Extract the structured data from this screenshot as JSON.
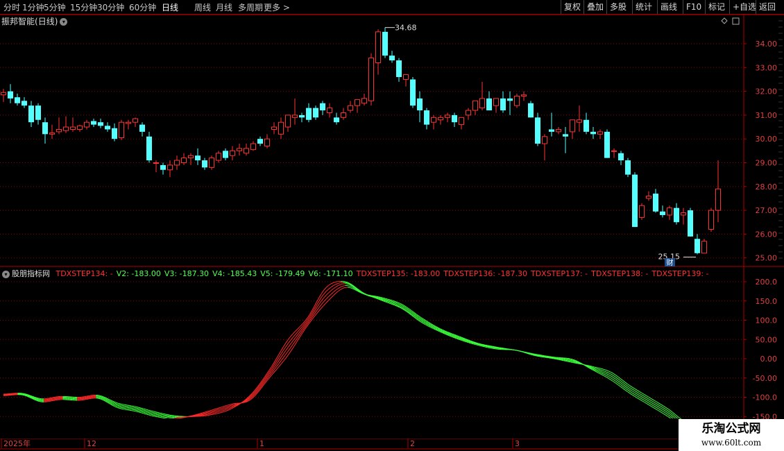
{
  "toolbar": {
    "periods": [
      "分时",
      "1分钟",
      "5分钟",
      "15分钟",
      "30分钟",
      "60分钟",
      "日线",
      "周线",
      "月线",
      "多周期",
      "更多 >"
    ],
    "active_index": 6,
    "right_buttons": [
      "复权",
      "叠加",
      "多股",
      "统计",
      "画线",
      "F10",
      "标记",
      "+自选",
      "返回"
    ]
  },
  "stock": {
    "name": "振邦智能",
    "period": "(日线)"
  },
  "colors": {
    "up": "#ff3232",
    "down": "#54ffff",
    "grid": "#8b0000",
    "axis": "#b00000"
  },
  "price_axis": {
    "labels": [
      "34.00",
      "33.00",
      "32.00",
      "31.00",
      "30.00",
      "29.00",
      "28.00",
      "27.00",
      "26.00",
      "25.00"
    ]
  },
  "annotations": {
    "high": "34.68",
    "low": "25.15",
    "finance_mark": "财"
  },
  "candles": [
    [
      31.85,
      32.1,
      31.55,
      31.95
    ],
    [
      32.0,
      32.3,
      31.5,
      31.7
    ],
    [
      31.75,
      31.9,
      31.4,
      31.5
    ],
    [
      31.6,
      31.75,
      31.3,
      31.4
    ],
    [
      31.4,
      31.6,
      30.5,
      30.7
    ],
    [
      31.4,
      31.5,
      30.6,
      30.8
    ],
    [
      30.7,
      30.9,
      29.8,
      30.2
    ],
    [
      30.2,
      30.6,
      30.0,
      30.25
    ],
    [
      30.3,
      30.9,
      30.2,
      30.4
    ],
    [
      30.35,
      30.95,
      30.25,
      30.5
    ],
    [
      30.4,
      30.9,
      30.3,
      30.5
    ],
    [
      30.4,
      30.6,
      30.3,
      30.55
    ],
    [
      30.5,
      30.8,
      30.4,
      30.7
    ],
    [
      30.75,
      30.85,
      30.5,
      30.6
    ],
    [
      30.7,
      30.85,
      30.45,
      30.55
    ],
    [
      30.55,
      30.7,
      30.3,
      30.4
    ],
    [
      30.45,
      30.65,
      29.9,
      30.0
    ],
    [
      30.05,
      30.8,
      29.95,
      30.7
    ],
    [
      30.65,
      30.8,
      30.4,
      30.7
    ],
    [
      30.7,
      30.9,
      30.5,
      30.85
    ],
    [
      30.6,
      30.7,
      30.1,
      30.3
    ],
    [
      30.1,
      30.3,
      29.0,
      29.1
    ],
    [
      29.0,
      29.1,
      28.6,
      29.0
    ],
    [
      28.9,
      29.0,
      28.5,
      28.7
    ],
    [
      28.7,
      29.1,
      28.4,
      28.9
    ],
    [
      28.9,
      29.3,
      28.7,
      29.1
    ],
    [
      29.0,
      29.4,
      28.9,
      29.2
    ],
    [
      29.2,
      29.4,
      28.9,
      29.3
    ],
    [
      29.3,
      29.6,
      28.9,
      29.1
    ],
    [
      29.1,
      29.2,
      28.7,
      28.8
    ],
    [
      28.8,
      29.3,
      28.7,
      29.2
    ],
    [
      29.1,
      29.5,
      29.0,
      29.4
    ],
    [
      29.5,
      29.6,
      29.1,
      29.2
    ],
    [
      29.3,
      29.7,
      29.1,
      29.5
    ],
    [
      29.5,
      29.8,
      29.3,
      29.6
    ],
    [
      29.4,
      29.8,
      29.3,
      29.6
    ],
    [
      29.55,
      29.9,
      29.5,
      29.8
    ],
    [
      30.0,
      30.1,
      29.7,
      29.8
    ],
    [
      29.7,
      30.2,
      29.6,
      30.0
    ],
    [
      30.4,
      30.7,
      30.2,
      30.5
    ],
    [
      30.2,
      30.9,
      30.0,
      30.7
    ],
    [
      30.5,
      31.0,
      30.3,
      31.0
    ],
    [
      30.9,
      31.7,
      30.6,
      31.0
    ],
    [
      31.0,
      31.1,
      30.7,
      30.9
    ],
    [
      31.3,
      31.5,
      30.7,
      30.8
    ],
    [
      31.3,
      31.4,
      30.8,
      30.9
    ],
    [
      31.5,
      31.6,
      31.0,
      31.2
    ],
    [
      31.1,
      31.5,
      30.9,
      31.3
    ],
    [
      30.9,
      31.1,
      30.6,
      30.7
    ],
    [
      30.9,
      31.3,
      30.8,
      31.1
    ],
    [
      31.2,
      31.6,
      31.1,
      31.4
    ],
    [
      31.4,
      31.5,
      31.1,
      31.65
    ],
    [
      31.5,
      31.9,
      31.4,
      31.7
    ],
    [
      31.6,
      33.6,
      31.4,
      33.4
    ],
    [
      33.2,
      34.6,
      32.7,
      34.5
    ],
    [
      34.5,
      34.68,
      33.4,
      33.5
    ],
    [
      33.5,
      33.7,
      33.2,
      33.3
    ],
    [
      33.3,
      33.4,
      32.4,
      32.6
    ],
    [
      32.5,
      32.7,
      32.2,
      32.7
    ],
    [
      32.5,
      32.6,
      31.3,
      31.4
    ],
    [
      31.7,
      32.0,
      30.7,
      31.2
    ],
    [
      31.2,
      31.3,
      30.4,
      30.6
    ],
    [
      30.7,
      31.0,
      30.4,
      30.9
    ],
    [
      30.8,
      31.0,
      30.6,
      30.9
    ],
    [
      30.9,
      31.1,
      30.7,
      31.0
    ],
    [
      31.0,
      31.1,
      30.5,
      30.7
    ],
    [
      30.6,
      30.9,
      30.4,
      30.9
    ],
    [
      31.0,
      31.3,
      30.8,
      31.2
    ],
    [
      31.2,
      31.6,
      31.0,
      31.6
    ],
    [
      31.3,
      32.4,
      31.2,
      31.7
    ],
    [
      31.7,
      32.0,
      31.2,
      31.2
    ],
    [
      31.4,
      31.7,
      31.1,
      31.7
    ],
    [
      31.7,
      32.0,
      31.1,
      31.2
    ],
    [
      31.7,
      32.0,
      31.0,
      31.6
    ],
    [
      31.4,
      31.9,
      31.3,
      31.8
    ],
    [
      31.8,
      32.0,
      31.6,
      31.85
    ],
    [
      31.5,
      31.6,
      30.9,
      30.9
    ],
    [
      30.9,
      31.1,
      29.7,
      29.8
    ],
    [
      29.8,
      30.2,
      29.1,
      30.1
    ],
    [
      30.4,
      31.1,
      30.1,
      30.3
    ],
    [
      30.3,
      30.5,
      30.2,
      30.4
    ],
    [
      30.2,
      30.5,
      29.4,
      30.1
    ],
    [
      30.3,
      30.8,
      30.0,
      30.8
    ],
    [
      30.7,
      31.4,
      30.3,
      30.8
    ],
    [
      30.8,
      31.1,
      30.2,
      30.3
    ],
    [
      30.3,
      30.5,
      30.0,
      30.2
    ],
    [
      30.2,
      30.4,
      30.0,
      30.3
    ],
    [
      30.3,
      30.4,
      29.2,
      29.2
    ],
    [
      29.5,
      29.6,
      29.2,
      29.5
    ],
    [
      29.4,
      29.5,
      28.9,
      29.1
    ],
    [
      29.1,
      29.2,
      28.4,
      28.5
    ],
    [
      28.5,
      28.6,
      26.3,
      26.3
    ],
    [
      26.7,
      27.3,
      26.6,
      27.2
    ],
    [
      27.5,
      27.8,
      27.4,
      27.6
    ],
    [
      27.7,
      27.9,
      26.9,
      26.95
    ],
    [
      26.95,
      27.2,
      26.7,
      26.8
    ],
    [
      26.8,
      27.2,
      26.6,
      27.1
    ],
    [
      27.1,
      27.3,
      26.4,
      26.5
    ],
    [
      26.8,
      27.1,
      26.4,
      26.9
    ],
    [
      27.0,
      27.1,
      25.9,
      25.9
    ],
    [
      25.8,
      26.0,
      25.15,
      25.2
    ],
    [
      25.2,
      25.8,
      25.2,
      25.7
    ],
    [
      26.2,
      27.1,
      26.1,
      27.0
    ],
    [
      27.0,
      29.1,
      26.5,
      27.9
    ]
  ],
  "indicator": {
    "name": "股朋指标网",
    "legend": [
      {
        "text": "TDXSTEP134: -",
        "color": "#ff3232"
      },
      {
        "text": "V2: -183.00",
        "color": "#54ff54"
      },
      {
        "text": "V3: -187.30",
        "color": "#54ff54"
      },
      {
        "text": "V4: -185.43",
        "color": "#54ff54"
      },
      {
        "text": "V5: -179.49",
        "color": "#54ff54"
      },
      {
        "text": "V6: -171.10",
        "color": "#54ff54"
      },
      {
        "text": "TDXSTEP135: -183.00",
        "color": "#ff3232"
      },
      {
        "text": "TDXSTEP136: -187.30",
        "color": "#ff3232"
      },
      {
        "text": "TDXSTEP137: -",
        "color": "#ff3232"
      },
      {
        "text": "TDXSTEP138: -",
        "color": "#ff3232"
      },
      {
        "text": "TDXSTEP139: -",
        "color": "#ff3232"
      }
    ],
    "axis_labels": [
      "200.0",
      "150.0",
      "100.0",
      "50.00",
      "0.00",
      "-50.00",
      "-100.0",
      "-150.0"
    ]
  },
  "chart_data": {
    "type": "line",
    "ylim": [
      -150,
      200
    ],
    "series": [
      {
        "name": "V2",
        "values": [
          -92,
          -90,
          -104,
          -98,
          -100,
          -95,
          -115,
          -125,
          -138,
          -148,
          -150,
          -145,
          -130,
          -95,
          -30,
          50,
          105,
          185,
          200,
          170,
          150,
          130,
          95,
          70,
          50,
          35,
          25,
          22,
          8,
          0,
          -10,
          -20,
          -35,
          -70,
          -100,
          -130,
          -165
        ]
      },
      {
        "name": "V3",
        "values": [
          -93,
          -91,
          -106,
          -100,
          -102,
          -97,
          -118,
          -128,
          -141,
          -150,
          -150,
          -142,
          -127,
          -98,
          -35,
          40,
          100,
          175,
          198,
          168,
          152,
          132,
          98,
          72,
          52,
          37,
          27,
          22,
          9,
          1,
          -8,
          -22,
          -40,
          -75,
          -105,
          -135,
          -170
        ]
      },
      {
        "name": "V4",
        "values": [
          -94,
          -92,
          -108,
          -102,
          -104,
          -99,
          -121,
          -131,
          -144,
          -152,
          -149,
          -139,
          -124,
          -101,
          -40,
          30,
          95,
          165,
          195,
          168,
          154,
          135,
          101,
          74,
          54,
          38,
          28,
          22,
          10,
          2,
          -6,
          -24,
          -45,
          -80,
          -110,
          -140,
          -175
        ]
      },
      {
        "name": "V5",
        "values": [
          -95,
          -93,
          -110,
          -104,
          -106,
          -101,
          -124,
          -134,
          -147,
          -154,
          -148,
          -136,
          -121,
          -104,
          -45,
          20,
          90,
          155,
          190,
          168,
          156,
          138,
          104,
          76,
          56,
          39,
          29,
          22,
          11,
          3,
          -4,
          -26,
          -50,
          -85,
          -115,
          -145,
          -180
        ]
      },
      {
        "name": "V6",
        "values": [
          -96,
          -94,
          -112,
          -106,
          -108,
          -103,
          -127,
          -137,
          -150,
          -156,
          -147,
          -133,
          -118,
          -107,
          -50,
          10,
          85,
          145,
          185,
          168,
          158,
          141,
          107,
          78,
          58,
          40,
          30,
          22,
          12,
          4,
          -2,
          -28,
          -55,
          -90,
          -120,
          -150,
          -185
        ]
      }
    ]
  },
  "date_axis": [
    "2025年",
    "12",
    "1",
    "2",
    "3"
  ],
  "watermark": {
    "title": "乐淘公式网",
    "url": "www.60lt.com"
  }
}
